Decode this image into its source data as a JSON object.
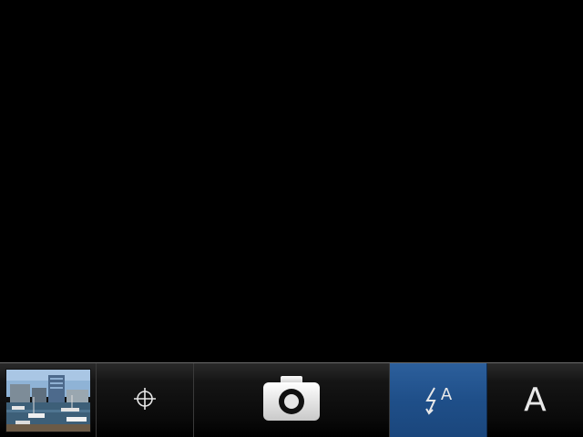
{
  "toolbar": {
    "thumbnail": {
      "icon": "gallery-thumbnail-icon"
    },
    "focus": {
      "icon": "crosshair-icon"
    },
    "shutter": {
      "icon": "camera-icon"
    },
    "flash": {
      "icon": "flash-auto-icon",
      "label": "A",
      "active_color": "#1f4f89"
    },
    "scene_mode": {
      "label": "A"
    }
  }
}
